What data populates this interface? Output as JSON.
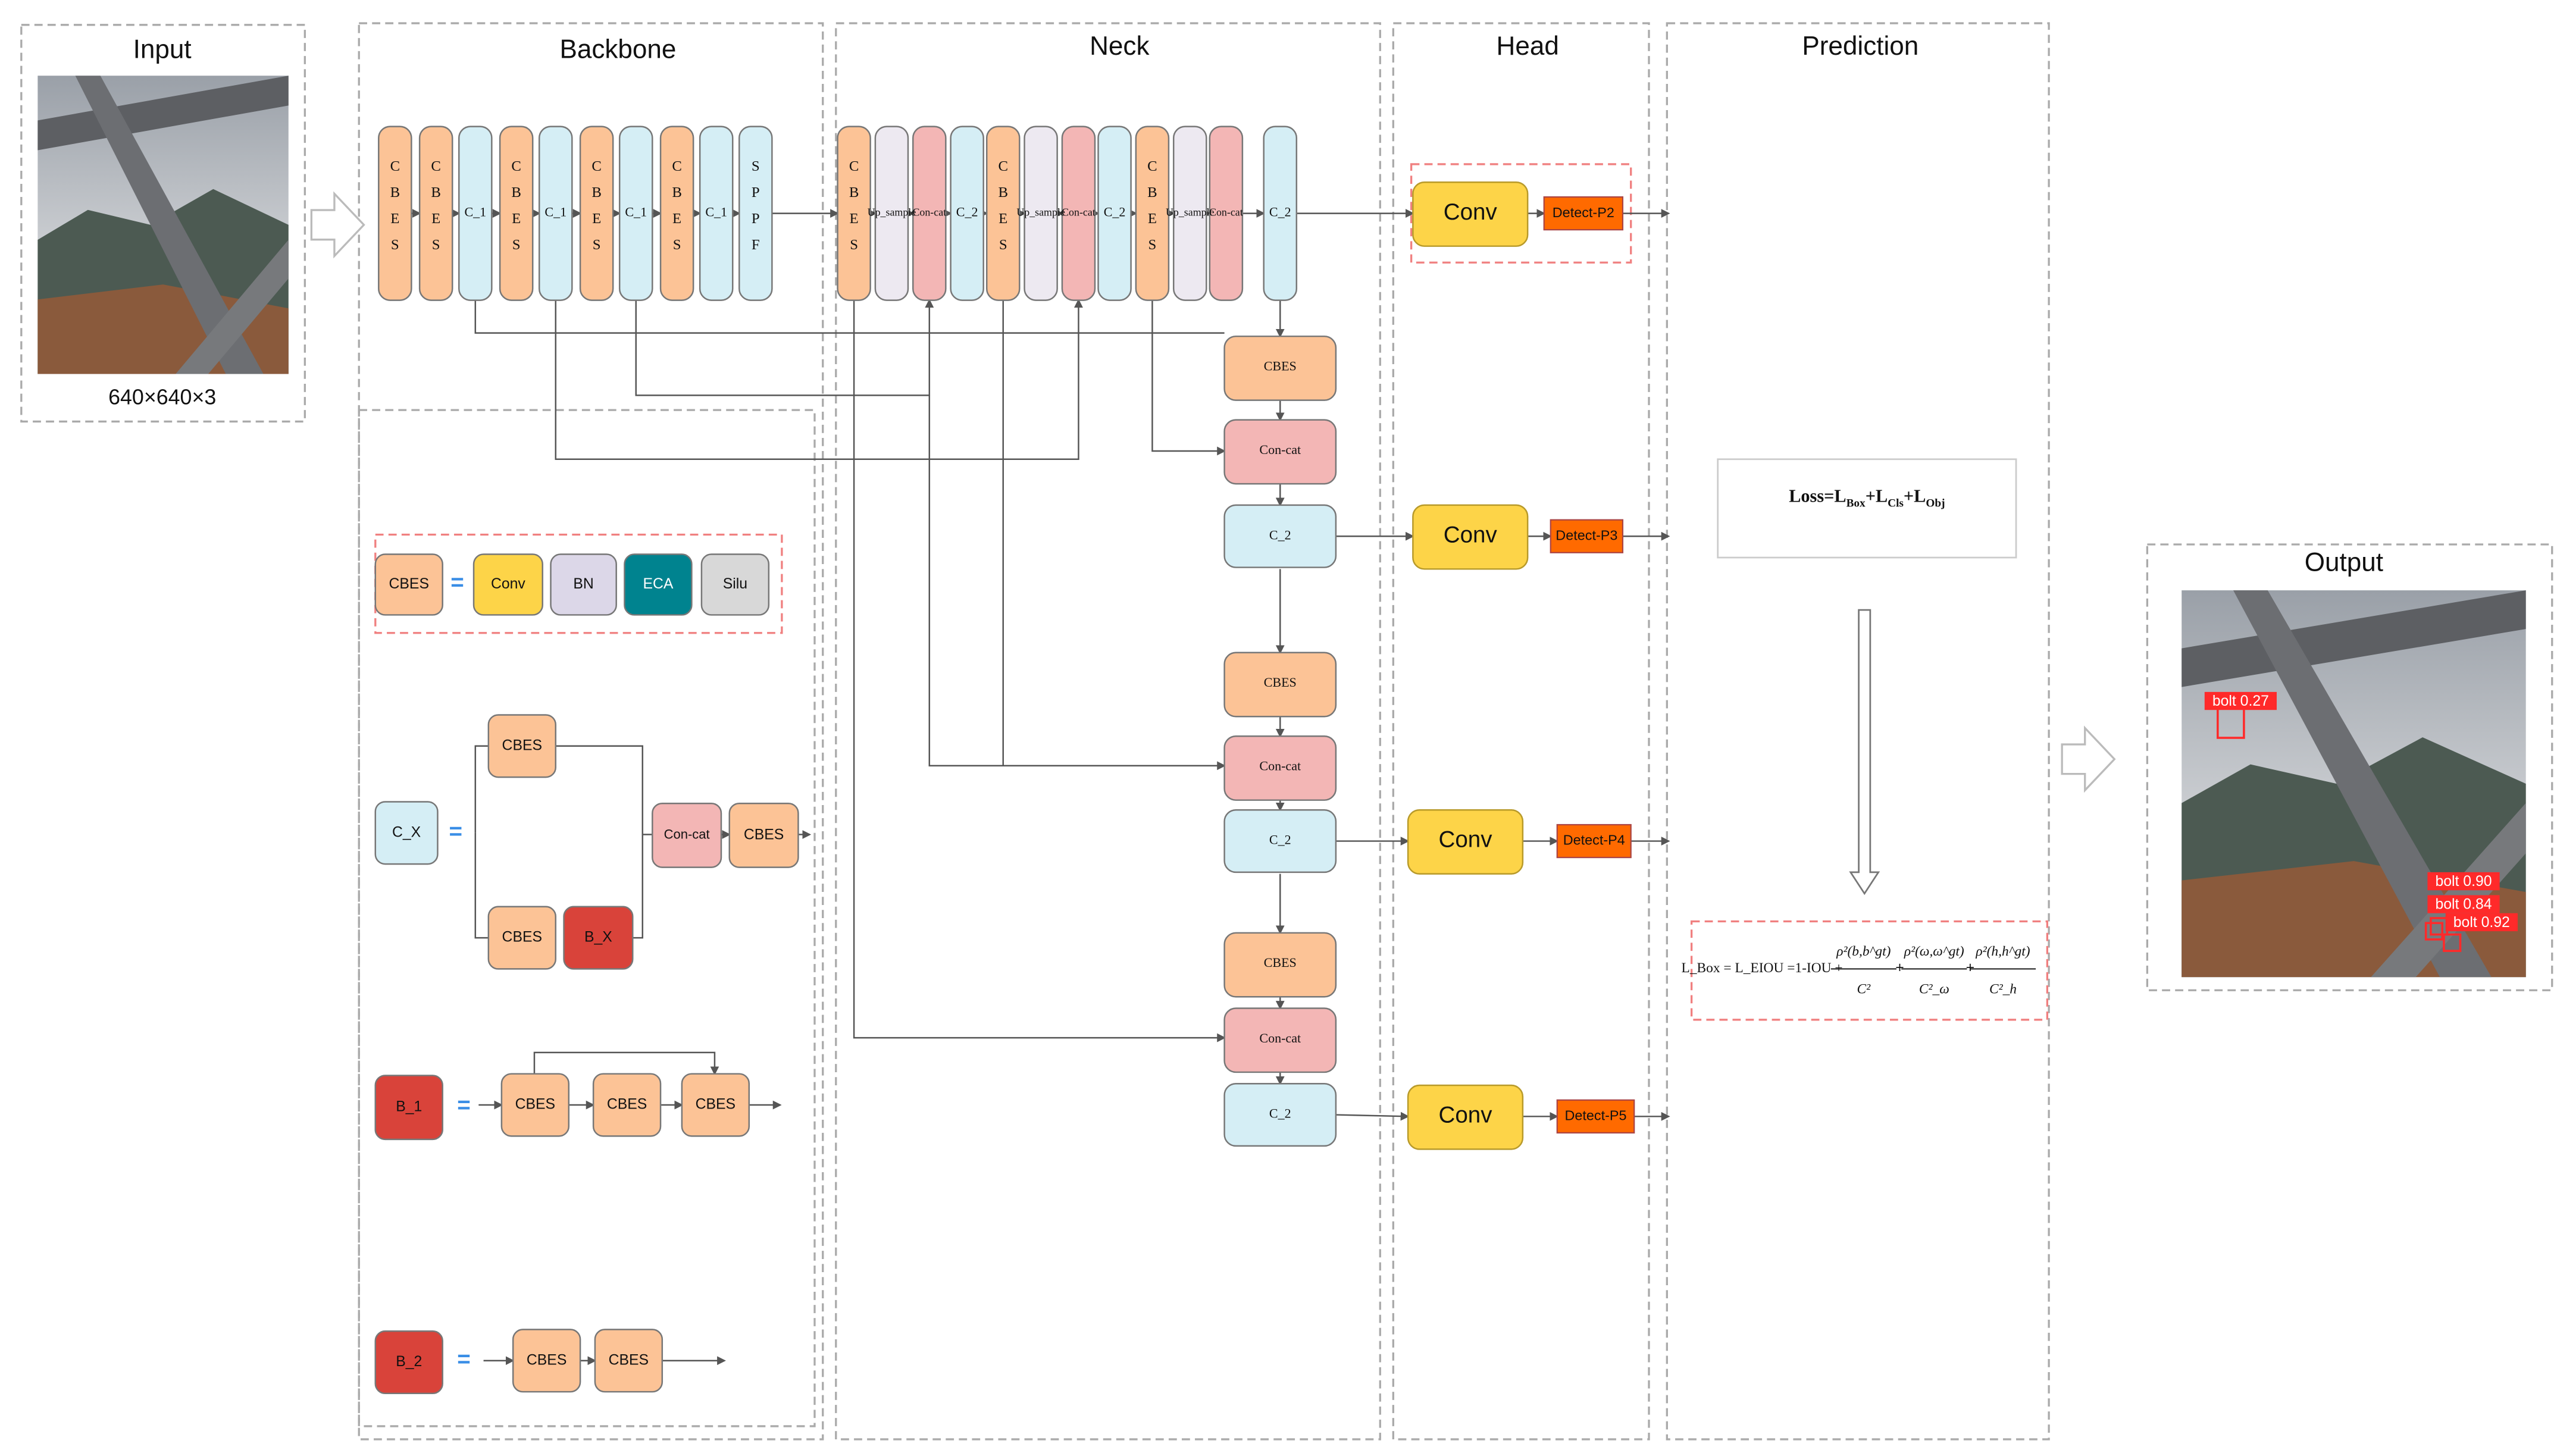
{
  "panels": {
    "input": "Input",
    "backbone": "Backbone",
    "neck": "Neck",
    "head": "Head",
    "prediction": "Prediction",
    "output": "Output"
  },
  "input_size": "640×640×3",
  "backbone_blocks": [
    "CBES",
    "CBES",
    "C_1",
    "CBES",
    "C_1",
    "CBES",
    "C_1",
    "CBES",
    "C_1",
    "SPPF"
  ],
  "neck_top_blocks": [
    "CBES",
    "Up_sample",
    "Con-cat",
    "C_2",
    "CBES",
    "Up_sample",
    "Con-cat",
    "C_2",
    "CBES",
    "Up_sample",
    "Con-cat",
    "C_2"
  ],
  "neck_column_blocks": [
    "CBES",
    "Con-cat",
    "C_2",
    "CBES",
    "Con-cat",
    "C_2",
    "CBES",
    "Con-cat",
    "C_2"
  ],
  "head": {
    "conv_label": "Conv",
    "detects": [
      "Detect-P2",
      "Detect-P3",
      "Detect-P4",
      "Detect-P5"
    ]
  },
  "prediction": {
    "loss": "Loss=L_Box+L_Cls+L_Obj",
    "loss_main": "Loss=L",
    "loss_terms": [
      "Box",
      "Cls",
      "Obj"
    ],
    "box_loss_lhs": "L_Box = L_EIOU =1-IOU +",
    "fractions": [
      {
        "num": "ρ²(b,b^gt)",
        "den": "C²"
      },
      {
        "num": "ρ²(ω,ω^gt)",
        "den": "C²_ω"
      },
      {
        "num": "ρ²(h,h^gt)",
        "den": "C²_h"
      }
    ]
  },
  "legend": {
    "cbes_def": [
      "CBES",
      "Conv",
      "BN",
      "ECA",
      "Silu"
    ],
    "cx_def": [
      "C_X",
      "CBES",
      "CBES",
      "B_X",
      "Con-cat",
      "CBES"
    ],
    "b1_def": [
      "B_1",
      "CBES",
      "CBES",
      "CBES"
    ],
    "b2_def": [
      "B_2",
      "CBES",
      "CBES"
    ],
    "equals": "="
  },
  "output_detections": [
    "bolt 0.27",
    "bolt 0.90",
    "bolt 0.84",
    "bolt 0.92"
  ],
  "colors": {
    "cbes": "#fcc396",
    "c1": "#d5eef5",
    "upsample": "#ede9f1",
    "concat": "#f3b6b5",
    "conv": "#fdd448",
    "detect": "#ff6a00",
    "eca": "#00838f",
    "bn": "#dcd7e8",
    "silu": "#d8d8d8",
    "bx": "#d9433a",
    "dash_red": "#f08080",
    "dash_gray": "#aaaaaa"
  }
}
